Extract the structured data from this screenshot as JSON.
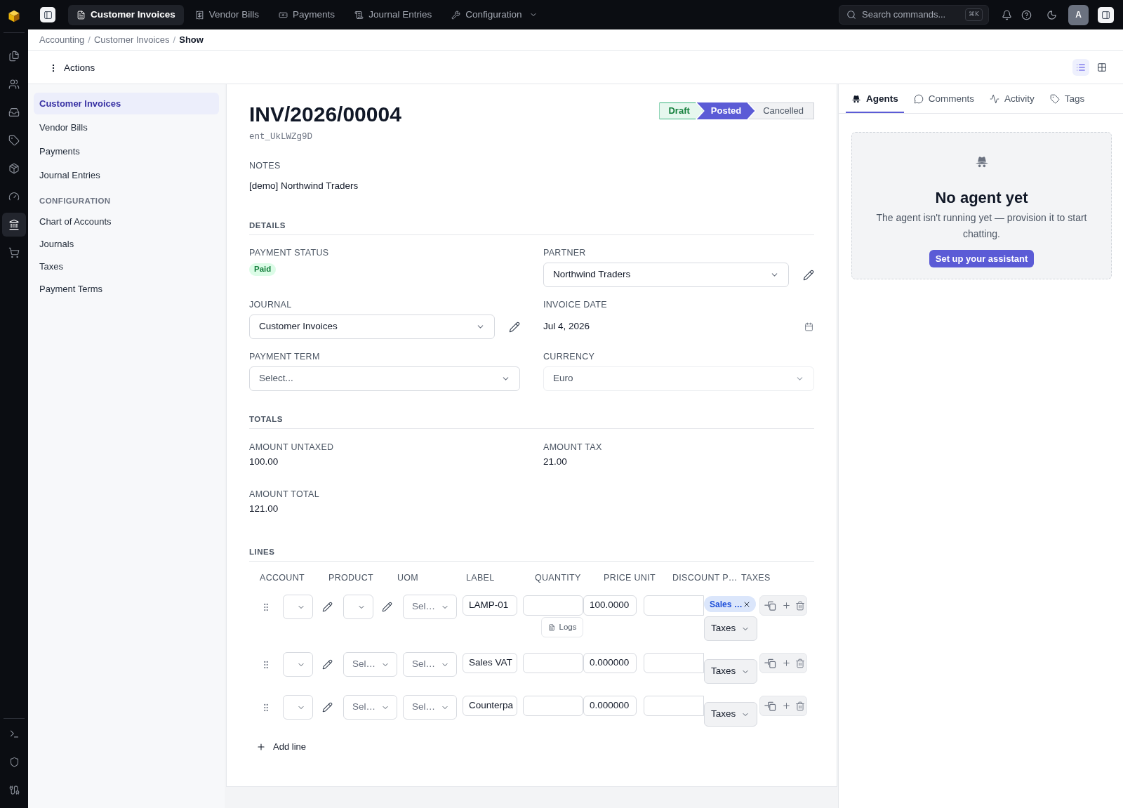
{
  "rail": {
    "items": [
      {
        "kind": "files",
        "selected": false
      },
      {
        "kind": "users",
        "selected": false
      },
      {
        "kind": "inbox",
        "selected": false
      },
      {
        "kind": "tag",
        "selected": false
      },
      {
        "kind": "box",
        "selected": false
      },
      {
        "kind": "gauge",
        "selected": false
      },
      {
        "kind": "bank",
        "selected": true
      },
      {
        "kind": "cart",
        "selected": false
      }
    ],
    "bottom_items": [
      {
        "kind": "terminal"
      },
      {
        "kind": "shield"
      },
      {
        "kind": "plug"
      }
    ]
  },
  "top_bar": {
    "tabs": [
      {
        "label": "Customer Invoices",
        "kind": "invoice",
        "selected": true,
        "has_menu": false
      },
      {
        "label": "Vendor Bills",
        "kind": "bill",
        "selected": false,
        "has_menu": false
      },
      {
        "label": "Payments",
        "kind": "payment",
        "selected": false,
        "has_menu": false
      },
      {
        "label": "Journal Entries",
        "kind": "journal",
        "selected": false,
        "has_menu": false
      },
      {
        "label": "Configuration",
        "kind": "config",
        "selected": false,
        "has_menu": true
      }
    ],
    "search": {
      "placeholder": "Search commands...",
      "shortcut": "⌘K"
    },
    "avatar": "A"
  },
  "breadcrumb": [
    {
      "label": "Accounting",
      "kind": "link"
    },
    {
      "label": "/",
      "kind": "separator"
    },
    {
      "label": "Customer Invoices",
      "kind": "link"
    },
    {
      "label": "/",
      "kind": "separator"
    },
    {
      "label": "Show",
      "kind": "current"
    }
  ],
  "actions_bar": {
    "label": "Actions",
    "view_modes": [
      {
        "kind": "list",
        "selected": true
      },
      {
        "kind": "grid",
        "selected": false
      }
    ]
  },
  "sidebar": {
    "items": [
      {
        "label": "Customer Invoices",
        "selected": true
      },
      {
        "label": "Vendor Bills",
        "selected": false
      },
      {
        "label": "Payments",
        "selected": false
      },
      {
        "label": "Journal Entries",
        "selected": false
      }
    ],
    "sections": [
      {
        "title": "CONFIGURATION",
        "items": [
          {
            "label": "Chart of Accounts",
            "selected": false
          },
          {
            "label": "Journals",
            "selected": false
          },
          {
            "label": "Taxes",
            "selected": false
          },
          {
            "label": "Payment Terms",
            "selected": false
          }
        ]
      }
    ]
  },
  "record": {
    "title": "INV/2026/00004",
    "id": "ent_UkLWZg9D",
    "status_steps": [
      {
        "label": "Draft",
        "done": true,
        "selected": false
      },
      {
        "label": "Posted",
        "done": false,
        "selected": true
      },
      {
        "label": "Cancelled",
        "done": false,
        "selected": false
      }
    ],
    "notes": {
      "label": "NOTES",
      "value": "[demo] Northwind Traders"
    },
    "details": {
      "title": "DETAILS",
      "fields": [
        {
          "label": "PAYMENT STATUS",
          "kind": "badge",
          "value": "Paid"
        },
        {
          "label": "PARTNER",
          "kind": "select",
          "value": "Northwind Traders",
          "editable": true,
          "disabled": false
        },
        {
          "label": "JOURNAL",
          "kind": "select",
          "value": "Customer Invoices",
          "editable": true,
          "disabled": false
        },
        {
          "label": "INVOICE DATE",
          "kind": "date",
          "value": "Jul 4, 2026"
        },
        {
          "label": "PAYMENT TERM",
          "kind": "select",
          "placeholder": "Select...",
          "editable": false,
          "disabled": false
        },
        {
          "label": "CURRENCY",
          "kind": "select",
          "value": "Euro",
          "editable": false,
          "disabled": true
        }
      ]
    },
    "totals": {
      "title": "TOTALS",
      "fields": [
        {
          "label": "AMOUNT UNTAXED",
          "value": "100.00"
        },
        {
          "label": "AMOUNT TAX",
          "value": "21.00"
        },
        {
          "label": "AMOUNT TOTAL",
          "value": "121.00"
        }
      ]
    },
    "lines": {
      "title": "LINES",
      "columns": [
        "ACCOUNT",
        "PRODUCT",
        "UOM",
        "LABEL",
        "QUANTITY",
        "PRICE UNIT",
        "DISCOUNT P…",
        "TAXES"
      ],
      "rows": [
        {
          "product": {
            "editable": true
          },
          "uom": {
            "placeholder": "Sel…"
          },
          "label": "LAMP-01",
          "logs_button": "Logs",
          "price_unit": "100.0000",
          "tax_tags": [
            {
              "label": "Sales …"
            }
          ],
          "taxes_button": "Taxes"
        },
        {
          "product": {
            "editable": false,
            "placeholder": "Sel…"
          },
          "uom": {
            "placeholder": "Sel…"
          },
          "label": "Sales VAT",
          "price_unit": "0.000000",
          "taxes_button": "Taxes"
        },
        {
          "product": {
            "editable": false,
            "placeholder": "Sel…"
          },
          "uom": {
            "placeholder": "Sel…"
          },
          "label": "Counterpa",
          "price_unit": "0.000000",
          "taxes_button": "Taxes"
        }
      ],
      "add_line": "Add line"
    }
  },
  "right_panel": {
    "tabs": [
      {
        "label": "Agents",
        "kind": "agent",
        "selected": true
      },
      {
        "label": "Comments",
        "kind": "comment",
        "selected": false
      },
      {
        "label": "Activity",
        "kind": "activity",
        "selected": false
      },
      {
        "label": "Tags",
        "kind": "tag",
        "selected": false
      }
    ],
    "empty_state": {
      "title": "No agent yet",
      "text": "The agent isn't running yet — provision it to start chatting.",
      "button": "Set up your assistant"
    }
  }
}
